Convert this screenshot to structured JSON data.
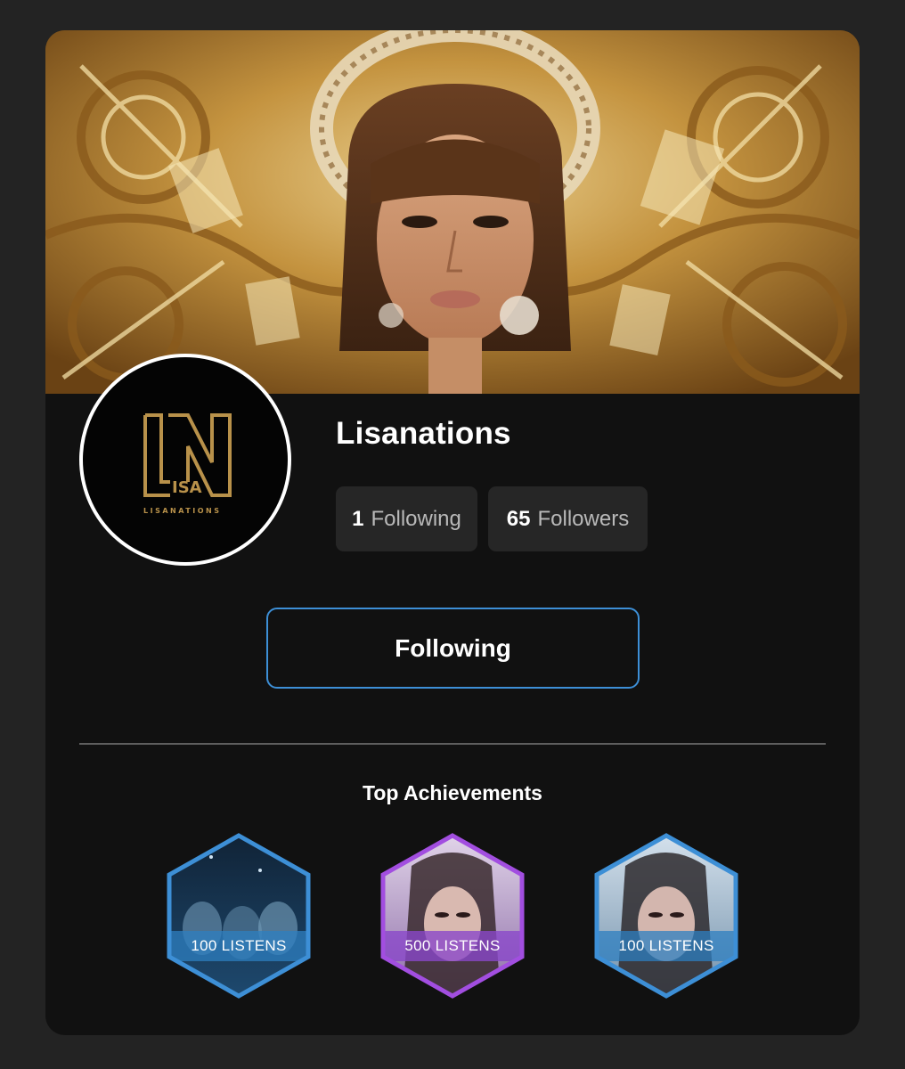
{
  "profile": {
    "name": "Lisanations",
    "avatar_logo_text": "LISANATIONS"
  },
  "stats": {
    "following_count": "1",
    "following_label": "Following",
    "followers_count": "65",
    "followers_label": "Followers"
  },
  "actions": {
    "follow_button_label": "Following"
  },
  "achievements": {
    "title": "Top Achievements",
    "items": [
      {
        "label": "100 LISTENS",
        "tier_color": "#3d8fd6"
      },
      {
        "label": "500 LISTENS",
        "tier_color": "#a24ee0"
      },
      {
        "label": "100 LISTENS",
        "tier_color": "#3d8fd6"
      }
    ]
  },
  "colors": {
    "background": "#232323",
    "card": "#111111",
    "pill": "#262626",
    "accent_blue": "#3d8fd6",
    "accent_purple": "#a24ee0",
    "logo_gold": "#b8914a"
  }
}
